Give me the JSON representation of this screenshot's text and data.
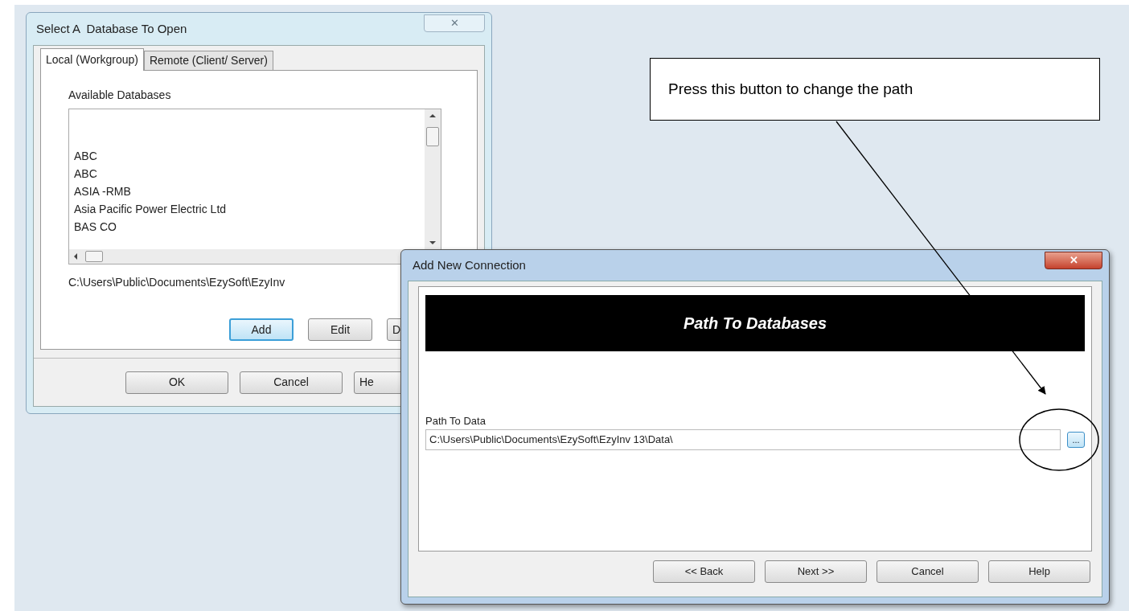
{
  "dialog_1": {
    "title": "Select A  Database To Open",
    "close": "✕",
    "tabs": [
      {
        "label": "Local (Workgroup)",
        "selected": true
      },
      {
        "label": "Remote (Client/ Server)",
        "selected": false
      }
    ],
    "list_label": "Available Databases",
    "list_items": [
      "ABC",
      "ABC",
      "ASIA -RMB",
      "Asia Pacific Power Electric Ltd",
      "BAS CO"
    ],
    "path": "C:\\Users\\Public\\Documents\\EzySoft\\EzyInv",
    "buttons": [
      {
        "label": "Add",
        "focused": true
      },
      {
        "label": "Edit",
        "focused": false
      },
      {
        "label": "D",
        "focused": false
      }
    ],
    "footer_buttons": [
      {
        "label": "OK",
        "focused": false
      },
      {
        "label": "Cancel",
        "focused": false
      },
      {
        "label": "He",
        "focused": false
      }
    ]
  },
  "dialog_2": {
    "title": "Add New Connection",
    "close": "✕",
    "banner": "Path To Databases",
    "field_label": "Path To Data",
    "field_value": "C:\\Users\\Public\\Documents\\EzySoft\\EzyInv 13\\Data\\",
    "browse": "...",
    "buttons": [
      {
        "label": "<< Back",
        "focused": false
      },
      {
        "label": "Next >>",
        "focused": false
      },
      {
        "label": "Cancel",
        "focused": false
      },
      {
        "label": "Help",
        "focused": false
      }
    ]
  },
  "callout": {
    "text": "Press this button to change the path"
  }
}
